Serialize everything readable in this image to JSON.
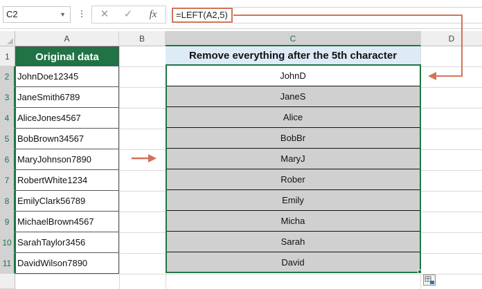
{
  "formula_bar": {
    "name_box": "C2",
    "cancel_glyph": "✕",
    "enter_glyph": "✓",
    "fx_label": "fx",
    "formula": "=LEFT(A2,5)"
  },
  "columns": [
    "A",
    "B",
    "C",
    "D"
  ],
  "rows": [
    "1",
    "2",
    "3",
    "4",
    "5",
    "6",
    "7",
    "8",
    "9",
    "10",
    "11"
  ],
  "column_a": {
    "header": "Original data",
    "values": [
      "JohnDoe12345",
      "JaneSmith6789",
      "AliceJones4567",
      "BobBrown34567",
      "MaryJohnson7890",
      "RobertWhite1234",
      "EmilyClark56789",
      "MichaelBrown4567",
      "SarahTaylor3456",
      "DavidWilson7890"
    ]
  },
  "column_c": {
    "header": "Remove everything after the 5th character",
    "values": [
      "JohnD",
      "JaneS",
      "Alice",
      "BobBr",
      "MaryJ",
      "Rober",
      "Emily",
      "Micha",
      "Sarah",
      "David"
    ]
  },
  "colors": {
    "header_green": "#217346",
    "header_blue": "#ddebf7",
    "arrow": "#d47257",
    "result_fill": "#d0d0d0"
  },
  "icons": [
    "cancel-icon",
    "enter-icon",
    "fx-icon",
    "right-arrow-icon",
    "quick-analysis-icon"
  ]
}
